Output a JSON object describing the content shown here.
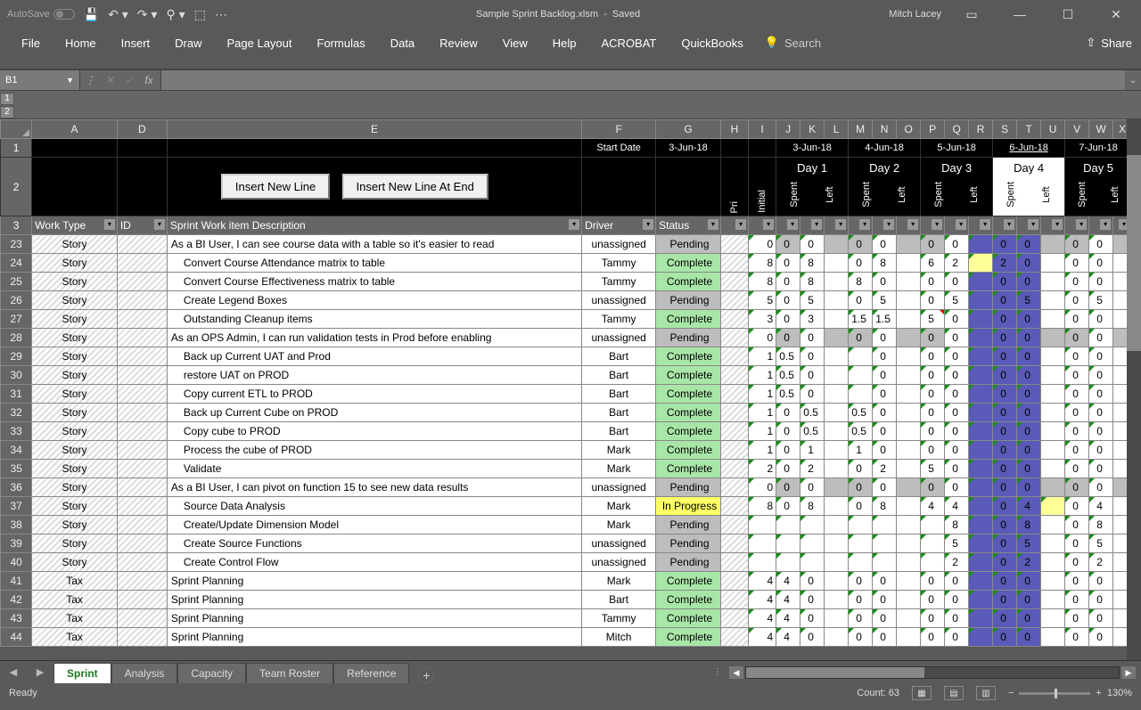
{
  "titlebar": {
    "autosave": "AutoSave",
    "filename": "Sample Sprint Backlog.xlsm",
    "state": "Saved",
    "user": "Mitch Lacey"
  },
  "ribbon": {
    "tabs": [
      "File",
      "Home",
      "Insert",
      "Draw",
      "Page Layout",
      "Formulas",
      "Data",
      "Review",
      "View",
      "Help",
      "ACROBAT",
      "QuickBooks"
    ],
    "search": "Search",
    "share": "Share"
  },
  "namebox": "B1",
  "outline_levels": [
    "1",
    "2"
  ],
  "columns": [
    "A",
    "D",
    "E",
    "F",
    "G",
    "H",
    "I",
    "J",
    "K",
    "L",
    "M",
    "N",
    "O",
    "P",
    "Q",
    "R",
    "S",
    "T",
    "U",
    "V",
    "W",
    "X"
  ],
  "header1": {
    "startdate_lbl": "Start Date",
    "startdate": "3-Jun-18",
    "dates": [
      "3-Jun-18",
      "4-Jun-18",
      "5-Jun-18",
      "6-Jun-18",
      "7-Jun-18"
    ]
  },
  "header2": {
    "btn1": "Insert New Line",
    "btn2": "Insert New Line At End",
    "pri": "Pri",
    "initial": "Initial",
    "days": [
      "Day 1",
      "Day 2",
      "Day 3",
      "Day 4",
      "Day 5"
    ],
    "spent": "Spent",
    "left": "Left"
  },
  "header3": {
    "worktype": "Work Type",
    "id": "ID",
    "desc": "Sprint Work item Description",
    "driver": "Driver",
    "status": "Status"
  },
  "sheettabs": [
    "Sprint",
    "Analysis",
    "Capacity",
    "Team Roster",
    "Reference"
  ],
  "statusbar": {
    "ready": "Ready",
    "count": "Count: 63",
    "zoom": "130%"
  },
  "rows": [
    {
      "n": "23",
      "wt": "Story",
      "desc": "As a BI User, I can see course data with a table so it's easier to read",
      "indent": 0,
      "driver": "unassigned",
      "status": "Pending",
      "init": "0",
      "d": [
        [
          "0",
          "0"
        ],
        [
          "0",
          "0"
        ],
        [
          "0",
          "0"
        ],
        [
          "0",
          "0"
        ],
        [
          "0",
          "0"
        ]
      ],
      "d4s": "0",
      "d4l": "0",
      "gray": true
    },
    {
      "n": "24",
      "wt": "Story",
      "desc": "Convert Course Attendance matrix to table",
      "indent": 1,
      "driver": "Tammy",
      "status": "Complete",
      "init": "8",
      "d": [
        [
          "0",
          "8"
        ],
        [
          "0",
          "8"
        ],
        [
          "6",
          "2"
        ],
        [
          "2",
          "0"
        ],
        [
          "0",
          "0"
        ]
      ],
      "d4s": "2",
      "d4l": "0",
      "d4yel": true
    },
    {
      "n": "25",
      "wt": "Story",
      "desc": "Convert Course Effectiveness matrix to table",
      "indent": 1,
      "driver": "Tammy",
      "status": "Complete",
      "init": "8",
      "d": [
        [
          "0",
          "8"
        ],
        [
          "8",
          "0"
        ],
        [
          "0",
          "0"
        ],
        [
          "0",
          "0"
        ],
        [
          "0",
          "0"
        ]
      ],
      "d4s": "0",
      "d4l": "0"
    },
    {
      "n": "26",
      "wt": "Story",
      "desc": "Create Legend Boxes",
      "indent": 1,
      "driver": "unassigned",
      "status": "Pending",
      "init": "5",
      "d": [
        [
          "0",
          "5"
        ],
        [
          "0",
          "5"
        ],
        [
          "0",
          "5"
        ],
        [
          "0",
          "5"
        ],
        [
          "0",
          "5"
        ]
      ],
      "d4s": "0",
      "d4l": "5"
    },
    {
      "n": "27",
      "wt": "Story",
      "desc": "Outstanding Cleanup items",
      "indent": 1,
      "driver": "Tammy",
      "status": "Complete",
      "init": "3",
      "d": [
        [
          "0",
          "3"
        ],
        [
          "1.5",
          "1.5"
        ],
        [
          "5",
          "0"
        ],
        [
          "0",
          "0"
        ],
        [
          "0",
          "0"
        ]
      ],
      "d4s": "0",
      "d4l": "0",
      "red3": true
    },
    {
      "n": "28",
      "wt": "Story",
      "desc": "As an OPS Admin, I can run validation tests in Prod before enabling",
      "indent": 0,
      "driver": "unassigned",
      "status": "Pending",
      "init": "0",
      "d": [
        [
          "0",
          "0"
        ],
        [
          "0",
          "0"
        ],
        [
          "0",
          "0"
        ],
        [
          "0",
          "0"
        ],
        [
          "0",
          "0"
        ]
      ],
      "d4s": "0",
      "d4l": "0",
      "gray": true
    },
    {
      "n": "29",
      "wt": "Story",
      "desc": "Back up Current UAT and Prod",
      "indent": 1,
      "driver": "Bart",
      "status": "Complete",
      "init": "1",
      "d": [
        [
          "0.5",
          "0"
        ],
        [
          "",
          "0"
        ],
        [
          "0",
          "0"
        ],
        [
          "0",
          "0"
        ],
        [
          "0",
          "0"
        ]
      ],
      "d4s": "0",
      "d4l": "0"
    },
    {
      "n": "30",
      "wt": "Story",
      "desc": "restore UAT on PROD",
      "indent": 1,
      "driver": "Bart",
      "status": "Complete",
      "init": "1",
      "d": [
        [
          "0.5",
          "0"
        ],
        [
          "",
          "0"
        ],
        [
          "0",
          "0"
        ],
        [
          "0",
          "0"
        ],
        [
          "0",
          "0"
        ]
      ],
      "d4s": "0",
      "d4l": "0"
    },
    {
      "n": "31",
      "wt": "Story",
      "desc": "Copy current ETL to PROD",
      "indent": 1,
      "driver": "Bart",
      "status": "Complete",
      "init": "1",
      "d": [
        [
          "0.5",
          "0"
        ],
        [
          "",
          "0"
        ],
        [
          "0",
          "0"
        ],
        [
          "0",
          "0"
        ],
        [
          "0",
          "0"
        ]
      ],
      "d4s": "0",
      "d4l": "0"
    },
    {
      "n": "32",
      "wt": "Story",
      "desc": "Back up Current Cube on PROD",
      "indent": 1,
      "driver": "Bart",
      "status": "Complete",
      "init": "1",
      "d": [
        [
          "0",
          "0.5"
        ],
        [
          "0.5",
          "0"
        ],
        [
          "0",
          "0"
        ],
        [
          "0",
          "0"
        ],
        [
          "0",
          "0"
        ]
      ],
      "d4s": "0",
      "d4l": "0"
    },
    {
      "n": "33",
      "wt": "Story",
      "desc": "Copy cube to PROD",
      "indent": 1,
      "driver": "Bart",
      "status": "Complete",
      "init": "1",
      "d": [
        [
          "0",
          "0.5"
        ],
        [
          "0.5",
          "0"
        ],
        [
          "0",
          "0"
        ],
        [
          "0",
          "0"
        ],
        [
          "0",
          "0"
        ]
      ],
      "d4s": "0",
      "d4l": "0"
    },
    {
      "n": "34",
      "wt": "Story",
      "desc": "Process the cube of PROD",
      "indent": 1,
      "driver": "Mark",
      "status": "Complete",
      "init": "1",
      "d": [
        [
          "0",
          "1"
        ],
        [
          "1",
          "0"
        ],
        [
          "0",
          "0"
        ],
        [
          "0",
          "0"
        ],
        [
          "0",
          "0"
        ]
      ],
      "d4s": "0",
      "d4l": "0"
    },
    {
      "n": "35",
      "wt": "Story",
      "desc": "Validate",
      "indent": 1,
      "driver": "Mark",
      "status": "Complete",
      "init": "2",
      "d": [
        [
          "0",
          "2"
        ],
        [
          "0",
          "2"
        ],
        [
          "5",
          "0"
        ],
        [
          "0",
          "0"
        ],
        [
          "0",
          "0"
        ]
      ],
      "d4s": "0",
      "d4l": "0"
    },
    {
      "n": "36",
      "wt": "Story",
      "desc": "As a BI User, I can pivot on function 15 to see new data results",
      "indent": 0,
      "driver": "unassigned",
      "status": "Pending",
      "init": "0",
      "d": [
        [
          "0",
          "0"
        ],
        [
          "0",
          "0"
        ],
        [
          "0",
          "0"
        ],
        [
          "0",
          "0"
        ],
        [
          "0",
          "0"
        ]
      ],
      "d4s": "0",
      "d4l": "0",
      "gray": true
    },
    {
      "n": "37",
      "wt": "Story",
      "desc": "Source Data Analysis",
      "indent": 1,
      "driver": "Mark",
      "status": "In Progress",
      "init": "8",
      "d": [
        [
          "0",
          "8"
        ],
        [
          "0",
          "8"
        ],
        [
          "4",
          "4"
        ],
        [
          "0",
          "4"
        ],
        [
          "0",
          "4"
        ]
      ],
      "d4s": "0",
      "d4l": "4",
      "d5yel": true
    },
    {
      "n": "38",
      "wt": "Story",
      "desc": "Create/Update Dimension Model",
      "indent": 1,
      "driver": "Mark",
      "status": "Pending",
      "init": "",
      "d": [
        [
          "",
          ""
        ],
        [
          "",
          ""
        ],
        [
          "",
          "8"
        ],
        [
          "0",
          "8"
        ],
        [
          "0",
          "8"
        ]
      ],
      "d4s": "0",
      "d4l": "8"
    },
    {
      "n": "39",
      "wt": "Story",
      "desc": "Create Source Functions",
      "indent": 1,
      "driver": "unassigned",
      "status": "Pending",
      "init": "",
      "d": [
        [
          "",
          ""
        ],
        [
          "",
          ""
        ],
        [
          "",
          "5"
        ],
        [
          "0",
          "5"
        ],
        [
          "0",
          "5"
        ]
      ],
      "d4s": "0",
      "d4l": "5"
    },
    {
      "n": "40",
      "wt": "Story",
      "desc": "Create Control Flow",
      "indent": 1,
      "driver": "unassigned",
      "status": "Pending",
      "init": "",
      "d": [
        [
          "",
          ""
        ],
        [
          "",
          ""
        ],
        [
          "",
          "2"
        ],
        [
          "0",
          "2"
        ],
        [
          "0",
          "2"
        ]
      ],
      "d4s": "0",
      "d4l": "2"
    },
    {
      "n": "41",
      "wt": "Tax",
      "desc": "Sprint Planning",
      "indent": 0,
      "driver": "Mark",
      "status": "Complete",
      "init": "4",
      "d": [
        [
          "4",
          "0"
        ],
        [
          "0",
          "0"
        ],
        [
          "0",
          "0"
        ],
        [
          "0",
          "0"
        ],
        [
          "0",
          "0"
        ]
      ],
      "d4s": "0",
      "d4l": "0"
    },
    {
      "n": "42",
      "wt": "Tax",
      "desc": "Sprint Planning",
      "indent": 0,
      "driver": "Bart",
      "status": "Complete",
      "init": "4",
      "d": [
        [
          "4",
          "0"
        ],
        [
          "0",
          "0"
        ],
        [
          "0",
          "0"
        ],
        [
          "0",
          "0"
        ],
        [
          "0",
          "0"
        ]
      ],
      "d4s": "0",
      "d4l": "0"
    },
    {
      "n": "43",
      "wt": "Tax",
      "desc": "Sprint Planning",
      "indent": 0,
      "driver": "Tammy",
      "status": "Complete",
      "init": "4",
      "d": [
        [
          "4",
          "0"
        ],
        [
          "0",
          "0"
        ],
        [
          "0",
          "0"
        ],
        [
          "0",
          "0"
        ],
        [
          "0",
          "0"
        ]
      ],
      "d4s": "0",
      "d4l": "0"
    },
    {
      "n": "44",
      "wt": "Tax",
      "desc": "Sprint Planning",
      "indent": 0,
      "driver": "Mitch",
      "status": "Complete",
      "init": "4",
      "d": [
        [
          "4",
          "0"
        ],
        [
          "0",
          "0"
        ],
        [
          "0",
          "0"
        ],
        [
          "0",
          "0"
        ],
        [
          "0",
          "0"
        ]
      ],
      "d4s": "0",
      "d4l": "0"
    }
  ]
}
